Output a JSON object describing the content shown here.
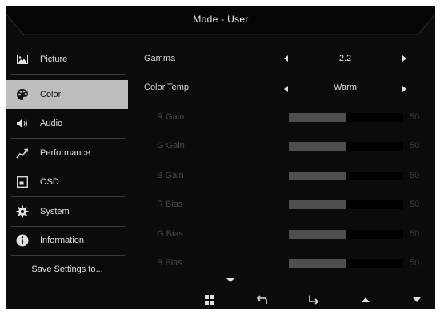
{
  "header": {
    "title": "Mode - User"
  },
  "sidebar": {
    "items": [
      {
        "label": "Picture",
        "icon": "picture-icon",
        "active": false
      },
      {
        "label": "Color",
        "icon": "palette-icon",
        "active": true
      },
      {
        "label": "Audio",
        "icon": "speaker-icon",
        "active": false
      },
      {
        "label": "Performance",
        "icon": "trend-arrow-icon",
        "active": false
      },
      {
        "label": "OSD",
        "icon": "osd-window-icon",
        "active": false
      },
      {
        "label": "System",
        "icon": "gear-icon",
        "active": false
      },
      {
        "label": "Information",
        "icon": "info-icon",
        "active": false
      }
    ],
    "save_label": "Save Settings to..."
  },
  "settings": {
    "gamma": {
      "label": "Gamma",
      "value": "2.2"
    },
    "color_temp": {
      "label": "Color Temp.",
      "value": "Warm"
    },
    "sliders": [
      {
        "label": "R Gain",
        "value": "50",
        "level": 0.5
      },
      {
        "label": "G Gain",
        "value": "50",
        "level": 0.5
      },
      {
        "label": "B Gain",
        "value": "50",
        "level": 0.5
      },
      {
        "label": "R Bias",
        "value": "50",
        "level": 0.5
      },
      {
        "label": "G Bias",
        "value": "50",
        "level": 0.5
      },
      {
        "label": "B Bias",
        "value": "50",
        "level": 0.5
      }
    ]
  },
  "footer": {
    "buttons": [
      "menu-grid-icon",
      "back-icon",
      "enter-icon",
      "up-arrow-icon",
      "down-arrow-icon"
    ]
  },
  "colors": {
    "background": "#0b0b0b",
    "active_item": "#bdbdbd",
    "slider_fill": "#4e4e4e",
    "dim_text": "#4a4a4a"
  }
}
